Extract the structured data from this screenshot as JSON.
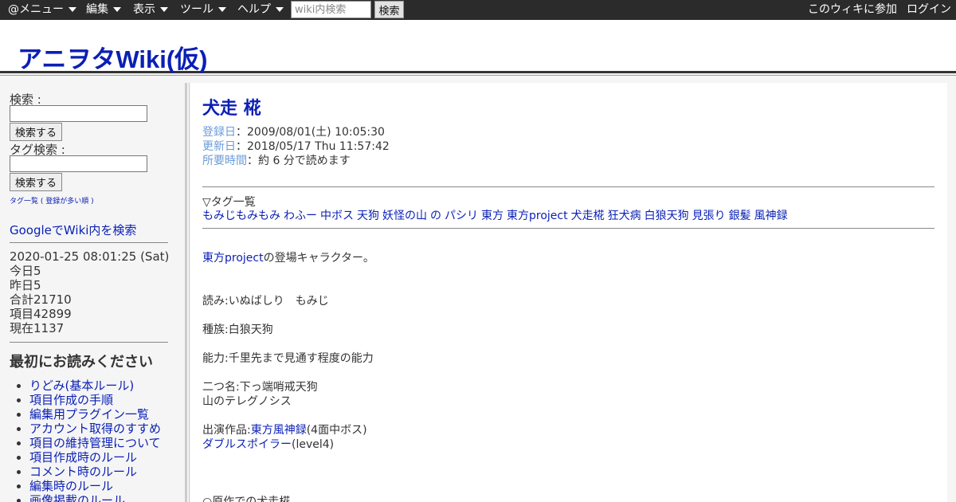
{
  "topbar": {
    "menus": [
      "@メニュー",
      "編集",
      "表示",
      "ツール",
      "ヘルプ"
    ],
    "search_placeholder": "wiki内検索",
    "search_button": "検索",
    "join_link": "このウィキに参加",
    "login_link": "ログイン"
  },
  "header": {
    "site_title": "アニヲタWiki(仮)"
  },
  "sidebar": {
    "search_label": "検索 :",
    "search_button": "検索する",
    "tag_search_label": "タグ検索 :",
    "tag_search_button": "検索する",
    "tag_list_link": "タグ一覧",
    "tag_list_paren_open": " ( ",
    "tag_list_popular": "登録が多い順",
    "tag_list_paren_close": " )",
    "google_search": "GoogleでWiki内を検索",
    "datetime": "2020-01-25 08:01:25 (Sat)",
    "today": "今日5",
    "yesterday": "昨日5",
    "total": "合計21710",
    "items": "項目42899",
    "now": "現在1137",
    "heading": "最初にお読みください",
    "links": [
      "りどみ(基本ルール)",
      "項目作成の手順",
      "編集用プラグイン一覧",
      "アカウント取得のすすめ",
      "項目の維持管理について",
      "項目作成時のルール",
      "コメント時のルール",
      "編集時のルール",
      "画像掲載のルール"
    ]
  },
  "main": {
    "title": "犬走 椛",
    "registered_label": "登録日",
    "registered_value": "：2009/08/01(土) 10:05:30",
    "updated_label": "更新日",
    "updated_value": "：2018/05/17 Thu 11:57:42",
    "readtime_label": "所要時間",
    "readtime_value": "：約 6 分で読めます",
    "tag_heading": "▽タグ一覧",
    "tags": [
      "もみじもみもみ",
      "わふー",
      "中ボス",
      "天狗",
      "妖怪の山",
      "の",
      "パシリ",
      "東方",
      "東方project",
      "犬走椛",
      "狂犬病",
      "白狼天狗",
      "見張り",
      "銀髪",
      "風神録"
    ],
    "intro_link": "東方project",
    "intro_text": "の登場キャラクター。",
    "reading": "読み:いぬばしり　もみじ",
    "race": "種族:白狼天狗",
    "ability": "能力:千里先まで見通す程度の能力",
    "alias1": "二つ名:下っ端哨戒天狗",
    "alias2": "山のテレグノシス",
    "appear_prefix": "出演作品:",
    "appear_link1": "東方風神録",
    "appear_suffix1": "(4面中ボス)",
    "appear_link2": "ダブルスポイラー",
    "appear_suffix2": "(level4)",
    "section": "○原作での犬走椛"
  }
}
